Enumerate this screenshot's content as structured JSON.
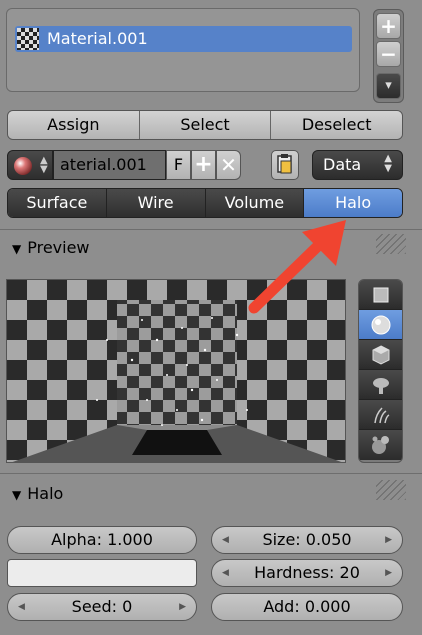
{
  "slots": {
    "items": [
      {
        "label": "Material.001",
        "selected": true
      }
    ],
    "add_label": "+",
    "remove_label": "−",
    "menu_label": "▾"
  },
  "assign_row": {
    "assign_label": "Assign",
    "select_label": "Select",
    "deselect_label": "Deselect"
  },
  "material": {
    "name_value": "aterial.001",
    "fake_user_label": "F",
    "new_label": "+",
    "unlink_label": "✕",
    "link_value": "Data"
  },
  "tabs": [
    {
      "label": "Surface",
      "active": false
    },
    {
      "label": "Wire",
      "active": false
    },
    {
      "label": "Volume",
      "active": false
    },
    {
      "label": "Halo",
      "active": true
    }
  ],
  "preview_panel": {
    "title": "Preview",
    "shapes": [
      "plane-icon",
      "sphere-icon",
      "cube-icon",
      "monkey-icon",
      "hair-icon",
      "sphere-bubbles-icon"
    ],
    "active_shape": "sphere-icon"
  },
  "halo_panel": {
    "title": "Halo",
    "alpha": "Alpha: 1.000",
    "size": "Size: 0.050",
    "hardness": "Hardness: 20",
    "seed": "Seed: 0",
    "add": "Add: 0.000",
    "color": "#ececec"
  },
  "annotation_arrow_color": "#f04430",
  "accent_color": "#5682c9"
}
